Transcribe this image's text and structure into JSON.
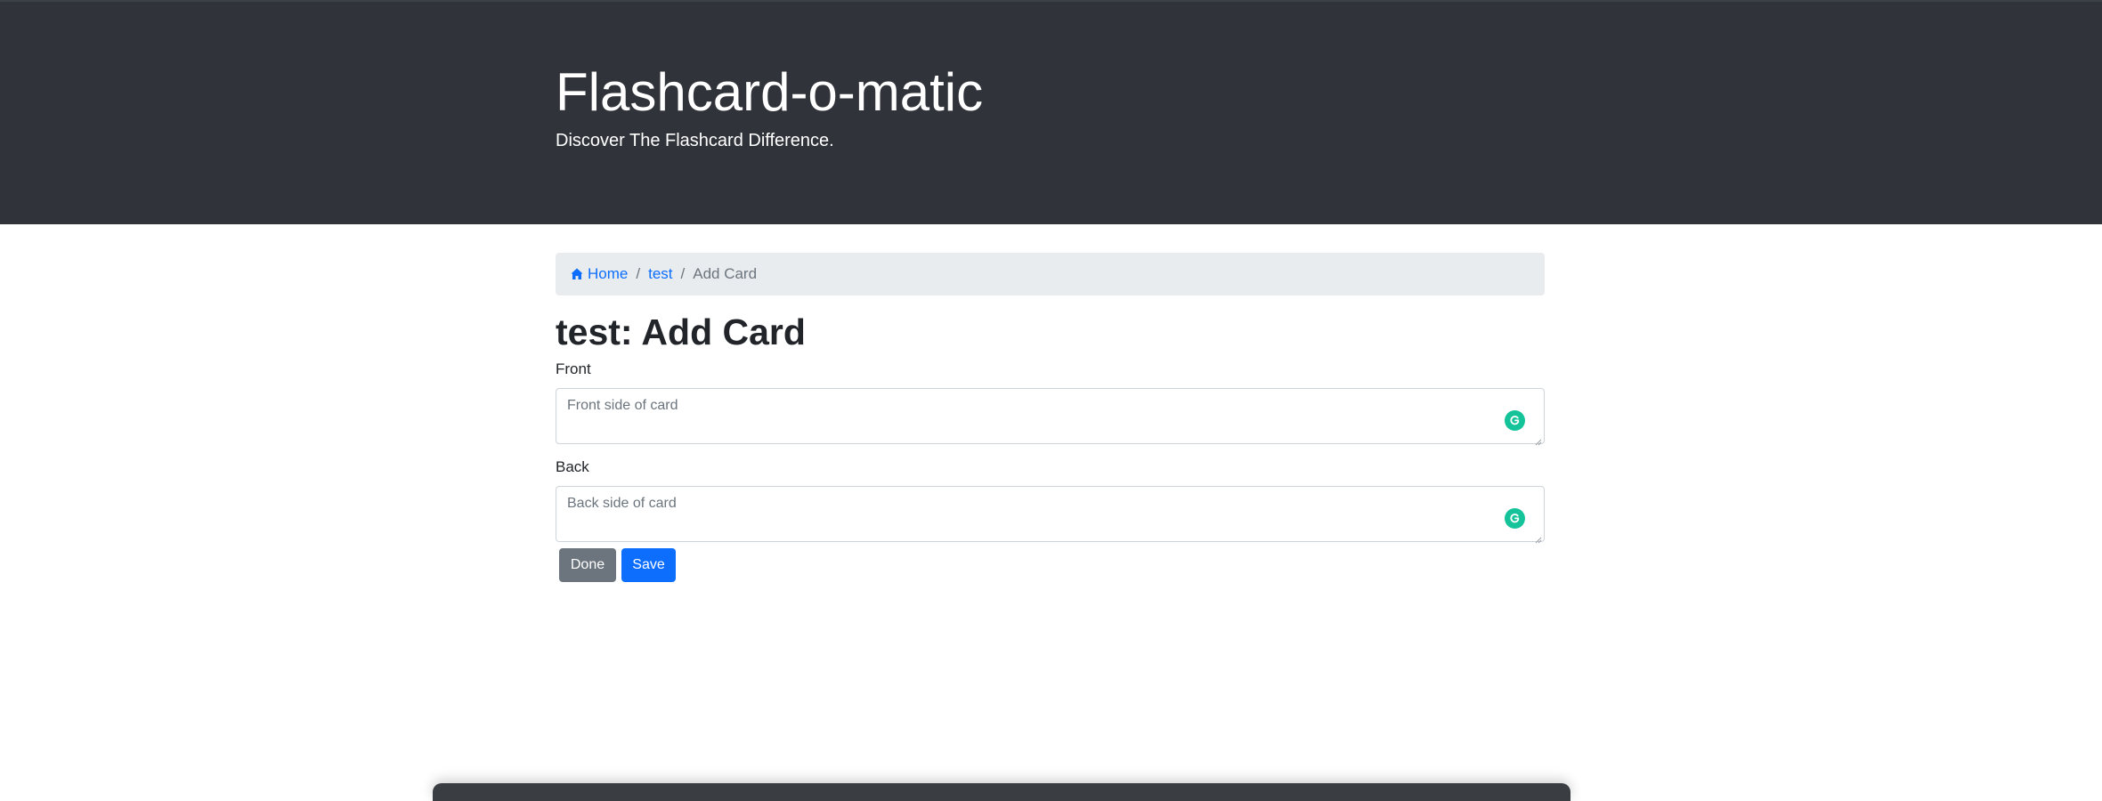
{
  "header": {
    "title": "Flashcard-o-matic",
    "subtitle": "Discover The Flashcard Difference."
  },
  "breadcrumb": {
    "home_icon": "home-icon",
    "items": [
      {
        "label": "Home"
      },
      {
        "label": "test"
      },
      {
        "label": "Add Card"
      }
    ],
    "separator": "/"
  },
  "page": {
    "heading": "test: Add Card"
  },
  "form": {
    "front": {
      "label": "Front",
      "value": "",
      "placeholder": "Front side of card",
      "assist_icon": "grammarly-icon"
    },
    "back": {
      "label": "Back",
      "value": "",
      "placeholder": "Back side of card",
      "assist_icon": "grammarly-icon"
    },
    "done_label": "Done",
    "save_label": "Save"
  },
  "colors": {
    "header_bg": "#30343a",
    "link": "#0d6efd",
    "done_button": "#6c757d",
    "save_button": "#0d6efd",
    "grammarly": "#15c39a"
  }
}
